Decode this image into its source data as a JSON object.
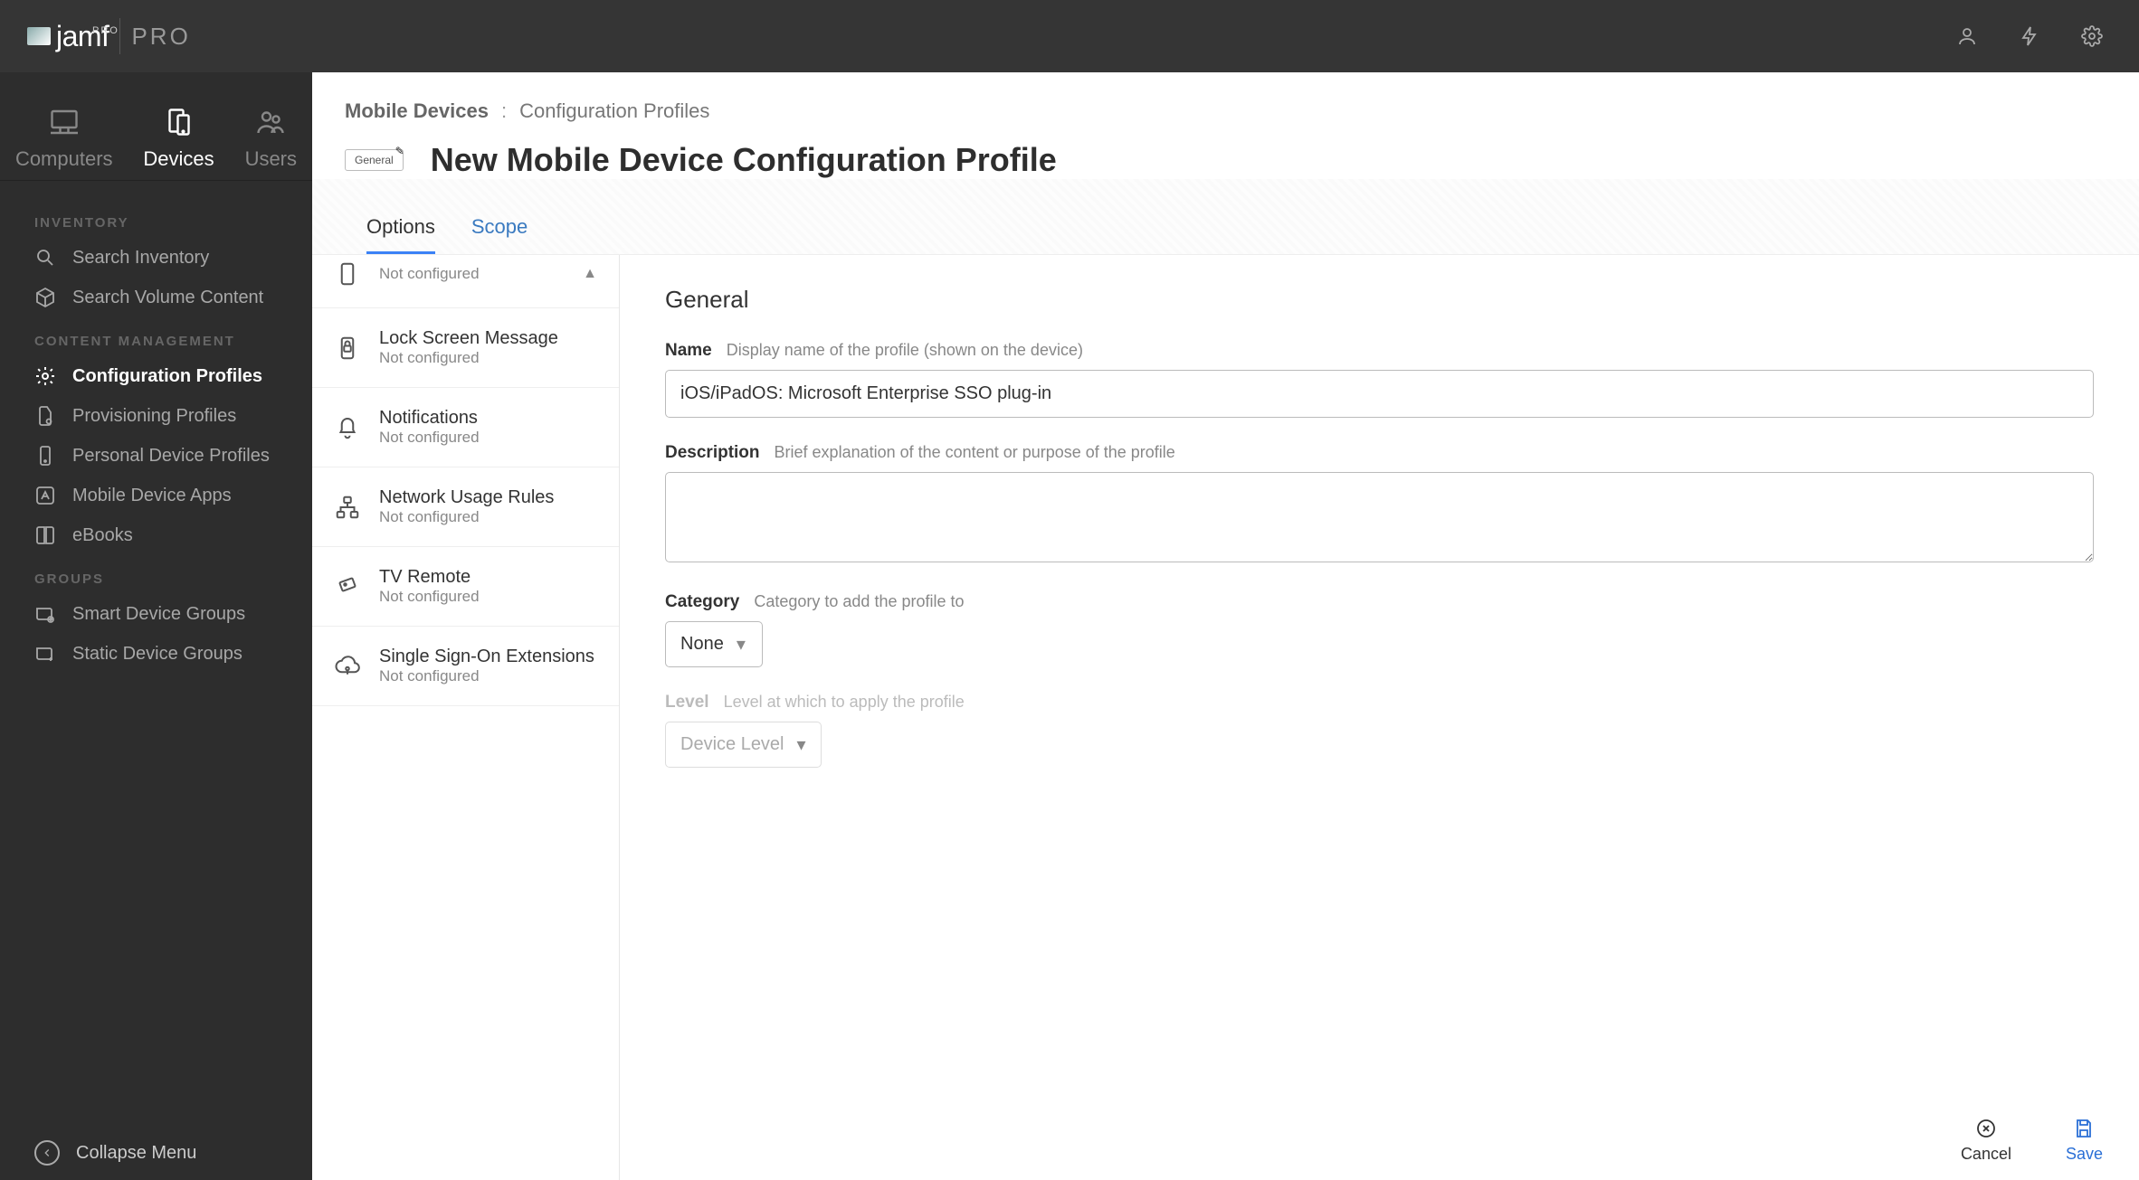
{
  "header": {
    "logo_above": "PRO",
    "logo_text": "jamf",
    "logo_pro": "PRO"
  },
  "sidebar": {
    "tabs": {
      "computers": "Computers",
      "devices": "Devices",
      "users": "Users"
    },
    "sections": {
      "inventory": "INVENTORY",
      "content_mgmt": "CONTENT MANAGEMENT",
      "groups": "GROUPS"
    },
    "items": {
      "search_inventory": "Search Inventory",
      "search_volume": "Search Volume Content",
      "config_profiles": "Configuration Profiles",
      "provisioning": "Provisioning Profiles",
      "personal_device": "Personal Device Profiles",
      "mobile_apps": "Mobile Device Apps",
      "ebooks": "eBooks",
      "smart_groups": "Smart Device Groups",
      "static_groups": "Static Device Groups"
    },
    "collapse": "Collapse Menu"
  },
  "breadcrumb": {
    "root": "Mobile Devices",
    "sep": ":",
    "current": "Configuration Profiles"
  },
  "page": {
    "pill": "General",
    "title": "New Mobile Device Configuration Profile",
    "tabs": {
      "options": "Options",
      "scope": "Scope"
    }
  },
  "payloads": {
    "not_configured": "Not configured",
    "items": [
      {
        "title": "",
        "sub": "Not configured"
      },
      {
        "title": "Lock Screen Message",
        "sub": "Not configured"
      },
      {
        "title": "Notifications",
        "sub": "Not configured"
      },
      {
        "title": "Network Usage Rules",
        "sub": "Not configured"
      },
      {
        "title": "TV Remote",
        "sub": "Not configured"
      },
      {
        "title": "Single Sign-On Extensions",
        "sub": "Not configured"
      }
    ]
  },
  "form": {
    "heading": "General",
    "name_label": "Name",
    "name_hint": "Display name of the profile (shown on the device)",
    "name_value": "iOS/iPadOS: Microsoft Enterprise SSO plug-in",
    "desc_label": "Description",
    "desc_hint": "Brief explanation of the content or purpose of the profile",
    "desc_value": "",
    "category_label": "Category",
    "category_hint": "Category to add the profile to",
    "category_value": "None",
    "level_label": "Level",
    "level_hint": "Level at which to apply the profile",
    "level_value": "Device Level"
  },
  "actions": {
    "cancel": "Cancel",
    "save": "Save"
  }
}
